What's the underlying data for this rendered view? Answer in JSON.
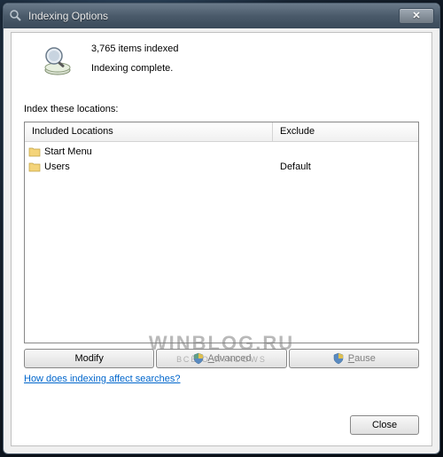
{
  "window": {
    "title": "Indexing Options"
  },
  "status": {
    "count_text": "3,765 items indexed",
    "complete_text": "Indexing complete."
  },
  "locations": {
    "label": "Index these locations:",
    "headers": {
      "included": "Included Locations",
      "exclude": "Exclude"
    },
    "rows": [
      {
        "included": "Start Menu",
        "exclude": ""
      },
      {
        "included": "Users",
        "exclude": "Default"
      }
    ]
  },
  "buttons": {
    "modify": "Modify",
    "advanced": "Advanced",
    "pause": "Pause",
    "close": "Close"
  },
  "link": {
    "text": "How does indexing affect searches?"
  },
  "watermark": {
    "line1": "WINBLOG.RU",
    "line2": "ВСЁ О WINDOWS"
  }
}
